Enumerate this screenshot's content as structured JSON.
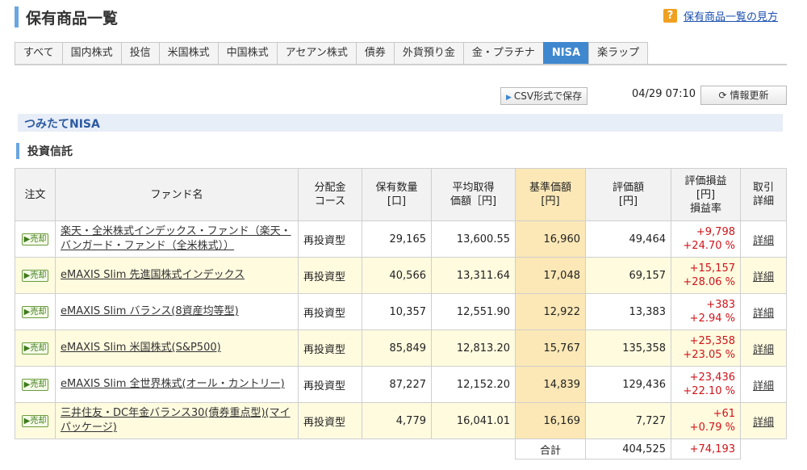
{
  "header": {
    "title": "保有商品一覧",
    "help_icon": "?",
    "help_link": "保有商品一覧の見方"
  },
  "tabs": [
    {
      "label": "すべて",
      "active": false
    },
    {
      "label": "国内株式",
      "active": false
    },
    {
      "label": "投信",
      "active": false
    },
    {
      "label": "米国株式",
      "active": false
    },
    {
      "label": "中国株式",
      "active": false
    },
    {
      "label": "アセアン株式",
      "active": false
    },
    {
      "label": "債券",
      "active": false
    },
    {
      "label": "外貨預り金",
      "active": false
    },
    {
      "label": "金・プラチナ",
      "active": false
    },
    {
      "label": "NISA",
      "active": true
    },
    {
      "label": "楽ラップ",
      "active": false
    }
  ],
  "toolbar": {
    "csv_label": "CSV形式で保存",
    "timestamp": "04/29 07:10",
    "refresh_label": "情報更新"
  },
  "section": {
    "label": "つみたてNISA"
  },
  "subsection": {
    "label": "投資信託"
  },
  "table": {
    "headers": {
      "order": "注文",
      "fund": "ファンド名",
      "dist_1": "分配金",
      "dist_2": "コース",
      "qty_1": "保有数量",
      "qty_2": "[口]",
      "avg_1": "平均取得",
      "avg_2": "価額［円]",
      "nav_1": "基準価額",
      "nav_2": "[円]",
      "val_1": "評価額",
      "val_2": "[円]",
      "pl_1": "評価損益",
      "pl_2": "[円]",
      "pl_3": "損益率",
      "det_1": "取引",
      "det_2": "詳細"
    },
    "sell_label": "売却",
    "detail_label": "詳細",
    "rows": [
      {
        "fund": "楽天・全米株式インデックス・ファンド（楽天・バンガード・ファンド（全米株式））",
        "course": "再投資型",
        "qty": "29,165",
        "avg": "13,600.55",
        "nav": "16,960",
        "value": "49,464",
        "pl": "+9,798",
        "rate": "+24.70 %"
      },
      {
        "fund": "eMAXIS Slim 先進国株式インデックス",
        "course": "再投資型",
        "qty": "40,566",
        "avg": "13,311.64",
        "nav": "17,048",
        "value": "69,157",
        "pl": "+15,157",
        "rate": "+28.06 %"
      },
      {
        "fund": "eMAXIS Slim バランス(8資産均等型)",
        "course": "再投資型",
        "qty": "10,357",
        "avg": "12,551.90",
        "nav": "12,922",
        "value": "13,383",
        "pl": "+383",
        "rate": "+2.94 %"
      },
      {
        "fund": "eMAXIS Slim 米国株式(S&P500)",
        "course": "再投資型",
        "qty": "85,849",
        "avg": "12,813.20",
        "nav": "15,767",
        "value": "135,358",
        "pl": "+25,358",
        "rate": "+23.05 %"
      },
      {
        "fund": "eMAXIS Slim 全世界株式(オール・カントリー)",
        "course": "再投資型",
        "qty": "87,227",
        "avg": "12,152.20",
        "nav": "14,839",
        "value": "129,436",
        "pl": "+23,436",
        "rate": "+22.10 %"
      },
      {
        "fund": "三井住友・DC年金バランス30(債券重点型)(マイパッケージ)",
        "course": "再投資型",
        "qty": "4,779",
        "avg": "16,041.01",
        "nav": "16,169",
        "value": "7,727",
        "pl": "+61",
        "rate": "+0.79 %"
      }
    ],
    "total": {
      "label": "合計",
      "value": "404,525",
      "pl": "+74,193"
    }
  }
}
